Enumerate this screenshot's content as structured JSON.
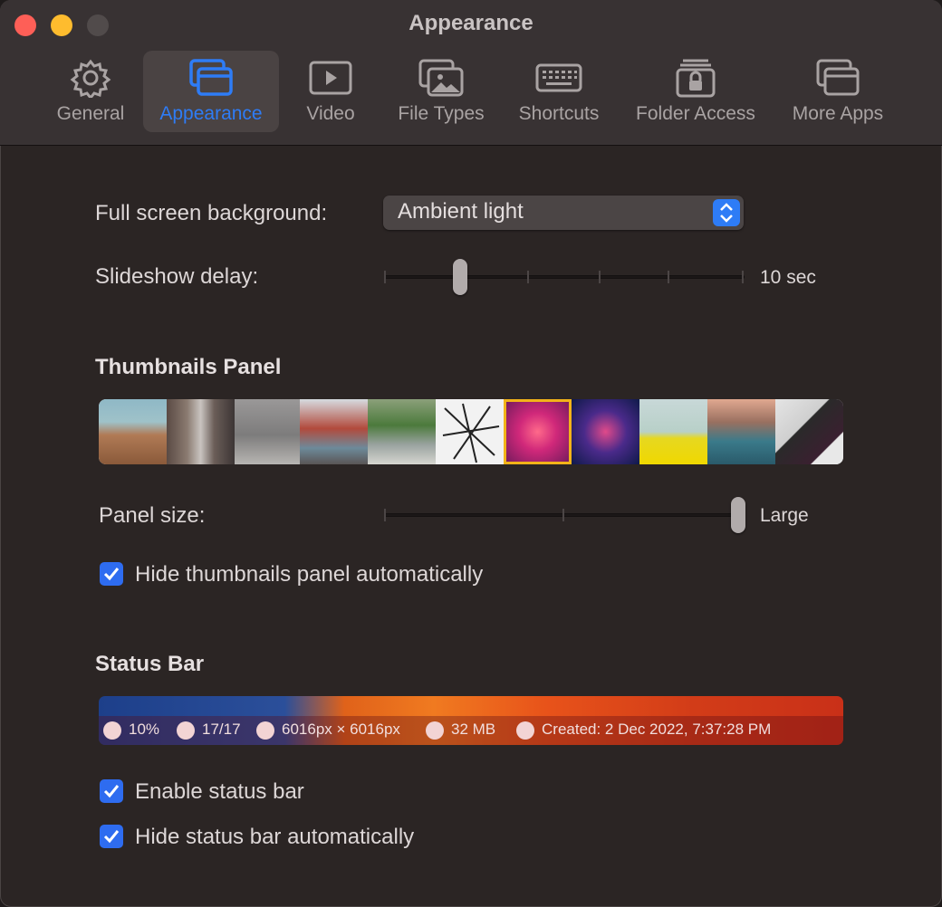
{
  "window": {
    "title": "Appearance"
  },
  "tabs": [
    {
      "label": "General",
      "icon": "gear-icon"
    },
    {
      "label": "Appearance",
      "icon": "windows-icon",
      "active": true
    },
    {
      "label": "Video",
      "icon": "play-icon"
    },
    {
      "label": "File Types",
      "icon": "photos-icon"
    },
    {
      "label": "Shortcuts",
      "icon": "keyboard-icon"
    },
    {
      "label": "Folder Access",
      "icon": "lock-folder-icon"
    },
    {
      "label": "More Apps",
      "icon": "apps-icon"
    }
  ],
  "settings": {
    "background_label": "Full screen background:",
    "background_value": "Ambient light",
    "slideshow_label": "Slideshow delay:",
    "slideshow_value": "10 sec"
  },
  "thumbnails": {
    "title": "Thumbnails Panel",
    "panel_size_label": "Panel size:",
    "panel_size_value": "Large",
    "hide_label": "Hide thumbnails panel automatically",
    "hide_checked": true
  },
  "status_bar": {
    "title": "Status Bar",
    "items": [
      {
        "icon": "zoom-icon",
        "text": "10%"
      },
      {
        "icon": "folder-icon",
        "text": "17/17"
      },
      {
        "icon": "dimensions-icon",
        "text": "6016px × 6016px"
      },
      {
        "icon": "archive-icon",
        "text": "32 MB"
      },
      {
        "icon": "calendar-icon",
        "text": "Created: 2 Dec 2022, 7:37:28 PM"
      }
    ],
    "enable_label": "Enable status bar",
    "enable_checked": true,
    "hide_label": "Hide status bar automatically",
    "hide_checked": true
  },
  "colors": {
    "accent": "#2e7cf6",
    "selection": "#f2b319"
  }
}
